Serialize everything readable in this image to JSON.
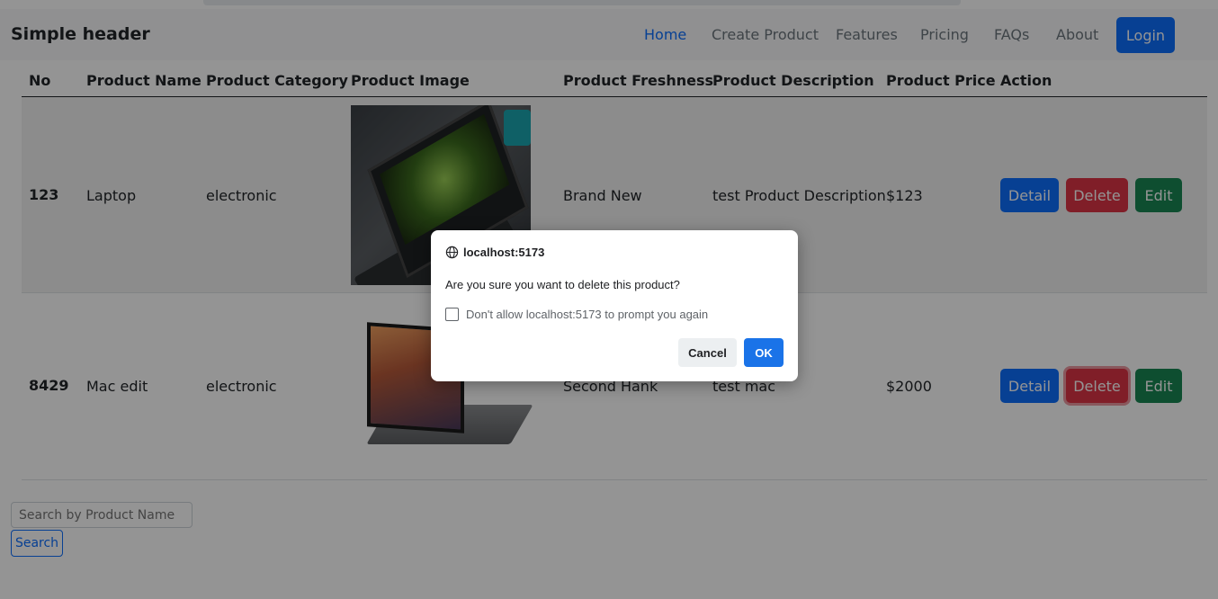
{
  "header": {
    "brand": "Simple header",
    "nav": [
      "Home",
      "Create Product",
      "Features",
      "Pricing",
      "FAQs",
      "About"
    ],
    "login_label": "Login"
  },
  "table": {
    "columns": [
      "No",
      "Product Name",
      "Product Category",
      "Product Image",
      "Product Freshness",
      "Product Description",
      "Product Price",
      "Action"
    ],
    "rows": [
      {
        "no": "123",
        "name": "Laptop",
        "category": "electronic",
        "image": "laptop-photo",
        "freshness": "Brand New",
        "description": "test Product Description",
        "price": "$123"
      },
      {
        "no": "8429",
        "name": "Mac edit",
        "category": "electronic",
        "image": "macbook-photo",
        "freshness": "Second Hank",
        "description": "test mac",
        "price": "$2000"
      }
    ],
    "actions": {
      "detail": "Detail",
      "delete": "Delete",
      "edit": "Edit"
    }
  },
  "search": {
    "placeholder": "Search by Product Name",
    "button_label": "Search"
  },
  "dialog": {
    "origin": "localhost:5173",
    "message": "Are you sure you want to delete this product?",
    "checkbox_label": "Don't allow localhost:5173 to prompt you again",
    "cancel_label": "Cancel",
    "ok_label": "OK"
  },
  "colors": {
    "primary": "#0d6efd",
    "danger": "#dc3545",
    "success": "#198754",
    "dialog_ok": "#1a73e8"
  }
}
